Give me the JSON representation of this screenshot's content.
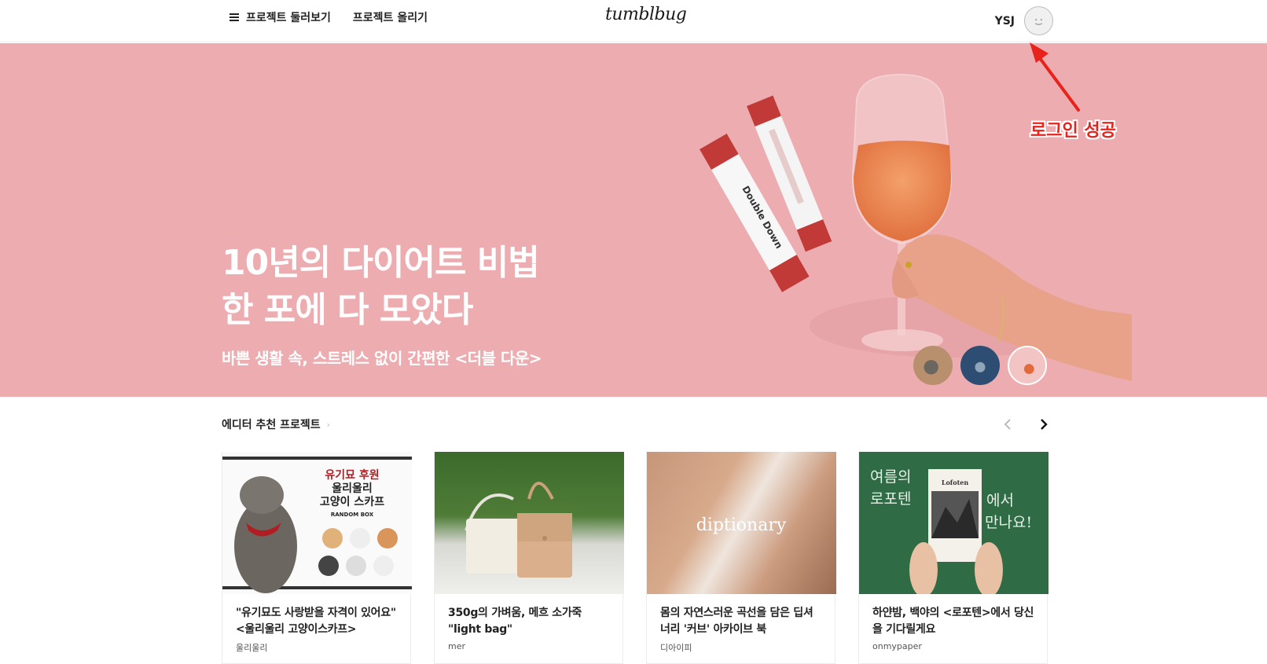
{
  "header": {
    "browse_label": "프로젝트 둘러보기",
    "upload_label": "프로젝트 올리기",
    "logo": "tumblbug",
    "username": "YSJ"
  },
  "hero": {
    "title": "10년의 다이어트 비법\n한 포에 다 모았다",
    "subtitle": "바쁜 생활 속, 스트레스 없이 간편한 <더블 다운>",
    "product_text": "Double Down",
    "background_color": "#ecacb0",
    "slides_count": 3,
    "active_slide": 3
  },
  "annotation": {
    "text": "로그인 성공",
    "color": "#e8231c"
  },
  "section": {
    "title": "에디터 추천 프로젝트",
    "prev_icon": "chevron-left-icon",
    "next_icon": "chevron-right-icon"
  },
  "cards": [
    {
      "title": "\"유기묘도 사랑받을 자격이 있어요\" <울리울리 고양이스카프>",
      "author": "울리울리",
      "image_text": [
        "유기묘 후원",
        "울리울리",
        "고양이 스카프",
        "RANDOM BOX"
      ]
    },
    {
      "title": "350g의 가벼움, 메흐 소가죽 \"light bag\"",
      "author": "mer"
    },
    {
      "title": "몸의 자연스러운 곡선을 담은 딥셔너리 '커브' 아카이브 북",
      "author": "디아이피",
      "image_text": "diptionary"
    },
    {
      "title": "하얀밤, 백야의 <로포텐>에서 당신을 기다릴게요",
      "author": "onmypaper",
      "image_text": [
        "여름의",
        "로포텐",
        "에서",
        "만나요!",
        "Lofoten"
      ]
    }
  ]
}
